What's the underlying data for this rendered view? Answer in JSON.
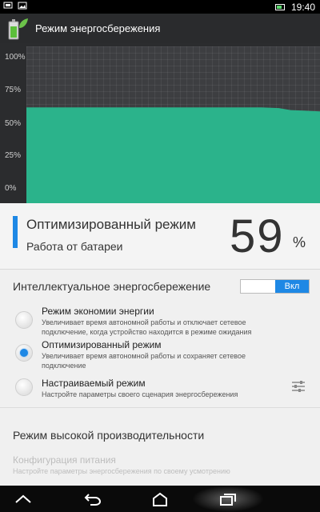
{
  "status_bar": {
    "time": "19:40"
  },
  "app": {
    "title": "Режим энергосбережения",
    "icon": "battery-leaf-icon"
  },
  "chart_data": {
    "type": "area",
    "y_ticks": [
      "100%",
      "75%",
      "50%",
      "25%",
      "0%"
    ],
    "ylim": [
      0,
      100
    ],
    "x": [
      0,
      0.2,
      0.4,
      0.6,
      0.8,
      0.86,
      0.9,
      1.0
    ],
    "values": [
      62,
      62,
      62,
      62,
      62,
      61.5,
      60,
      59
    ],
    "grid": true,
    "fill_color": "#2bb38b"
  },
  "mode": {
    "name": "Оптимизированный режим",
    "source": "Работа от батареи",
    "percent": "59",
    "percent_sign": "%"
  },
  "smart_saving": {
    "label": "Интеллектуальное энергосбережение",
    "toggle_label": "Вкл"
  },
  "options": [
    {
      "title": "Режим экономии энергии",
      "desc": "Увеличивает время автономной работы и отключает сетевое подключение, когда устройство находится в режиме ожидания"
    },
    {
      "title": "Оптимизированный режим",
      "desc": "Увеличивает время автономной работы и сохраняет сетевое подключение"
    },
    {
      "title": "Настраиваемый режим",
      "desc": "Настройте параметры своего сценария энергосбережения"
    }
  ],
  "performance": {
    "label": "Режим высокой производительности"
  },
  "power_config": {
    "title": "Конфигурация питания",
    "desc": "Настройте параметры энергосбережения по своему усмотрению"
  },
  "colors": {
    "accent": "#1e88e5",
    "chart_fill": "#2bb38b"
  }
}
